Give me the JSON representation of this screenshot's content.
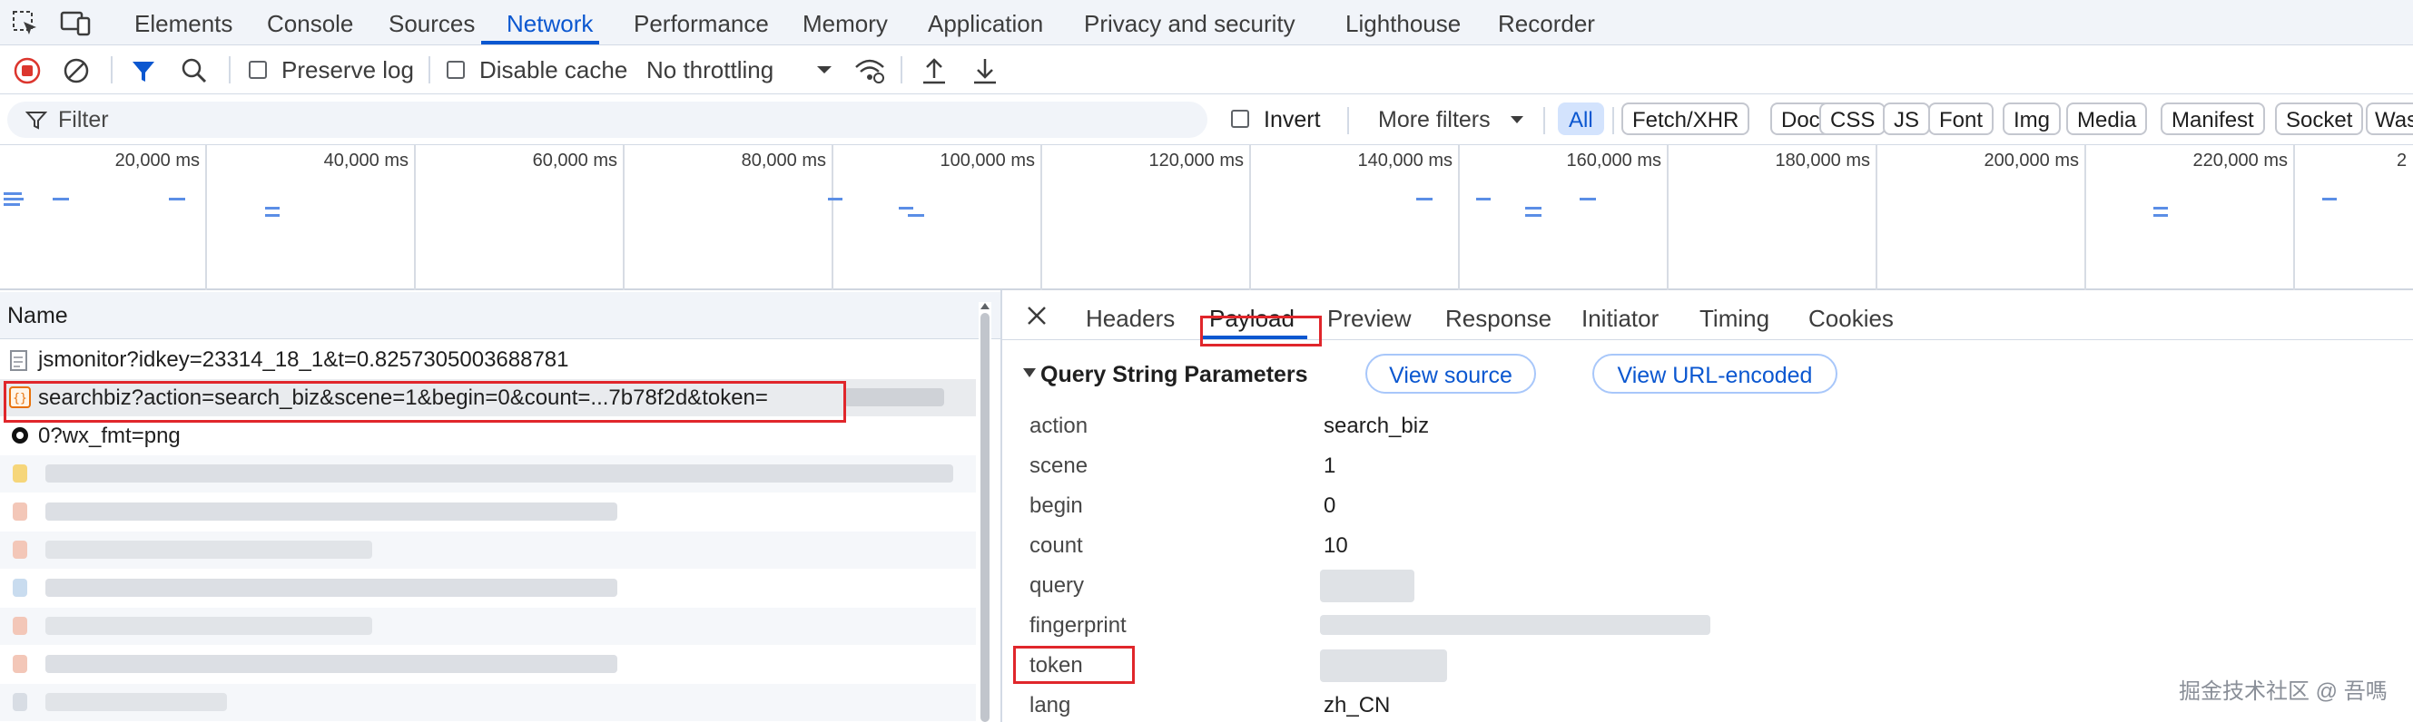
{
  "tabs": {
    "items": [
      "Elements",
      "Console",
      "Sources",
      "Network",
      "Performance",
      "Memory",
      "Application",
      "Privacy and security",
      "Lighthouse",
      "Recorder"
    ],
    "active": "Network"
  },
  "toolbar": {
    "preserve_log": "Preserve log",
    "disable_cache": "Disable cache",
    "throttling": "No throttling"
  },
  "filter": {
    "placeholder": "Filter",
    "invert": "Invert",
    "more_filters": "More filters",
    "types": [
      "All",
      "Fetch/XHR",
      "Doc",
      "CSS",
      "JS",
      "Font",
      "Img",
      "Media",
      "Manifest",
      "Socket",
      "Was"
    ]
  },
  "timeline": {
    "ticks": [
      "20,000 ms",
      "40,000 ms",
      "60,000 ms",
      "80,000 ms",
      "100,000 ms",
      "120,000 ms",
      "140,000 ms",
      "160,000 ms",
      "180,000 ms",
      "200,000 ms",
      "220,000 ms",
      "2"
    ]
  },
  "requests": {
    "header": "Name",
    "rows": [
      {
        "name": "jsmonitor?idkey=23314_18_1&t=0.8257305003688781",
        "icon": "document-icon"
      },
      {
        "name": "searchbiz?action=search_biz&scene=1&begin=0&count=...7b78f2d&token=",
        "icon": "xhr-braces-icon"
      },
      {
        "name": "0?wx_fmt=png",
        "icon": "image-icon"
      }
    ]
  },
  "detail": {
    "tabs": [
      "Headers",
      "Payload",
      "Preview",
      "Response",
      "Initiator",
      "Timing",
      "Cookies"
    ],
    "active_tab": "Payload",
    "section_title": "Query String Parameters",
    "view_source": "View source",
    "view_url_encoded": "View URL-encoded",
    "params": [
      {
        "key": "action",
        "value": "search_biz"
      },
      {
        "key": "scene",
        "value": "1"
      },
      {
        "key": "begin",
        "value": "0"
      },
      {
        "key": "count",
        "value": "10"
      },
      {
        "key": "query",
        "value": ""
      },
      {
        "key": "fingerprint",
        "value": ""
      },
      {
        "key": "token",
        "value": ""
      },
      {
        "key": "lang",
        "value": "zh_CN"
      }
    ]
  },
  "watermark": "掘金技术社区 @ 吾嗎",
  "colors": {
    "accent": "#0b57d0",
    "highlight_red": "#e0262b",
    "record_red": "#dc362e"
  }
}
